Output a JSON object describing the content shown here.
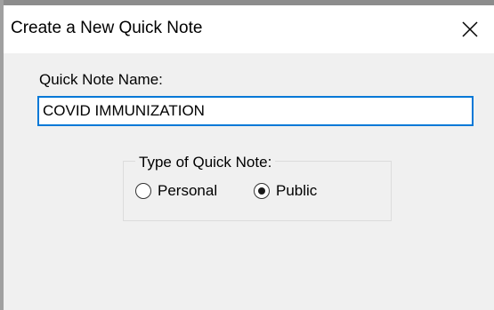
{
  "window": {
    "title": "Create a New Quick Note"
  },
  "form": {
    "name_label": "Quick Note Name:",
    "name_value": "COVID IMMUNIZATION",
    "type_group_label": "Type of Quick Note:",
    "type_options": [
      {
        "label": "Personal",
        "selected": false
      },
      {
        "label": "Public",
        "selected": true
      }
    ]
  },
  "colors": {
    "dialog_background": "#f0f0f0",
    "titlebar_background": "#ffffff",
    "input_focus_border": "#0078d7",
    "group_border": "#dcdcdc"
  },
  "icons": {
    "close": "close-icon"
  }
}
